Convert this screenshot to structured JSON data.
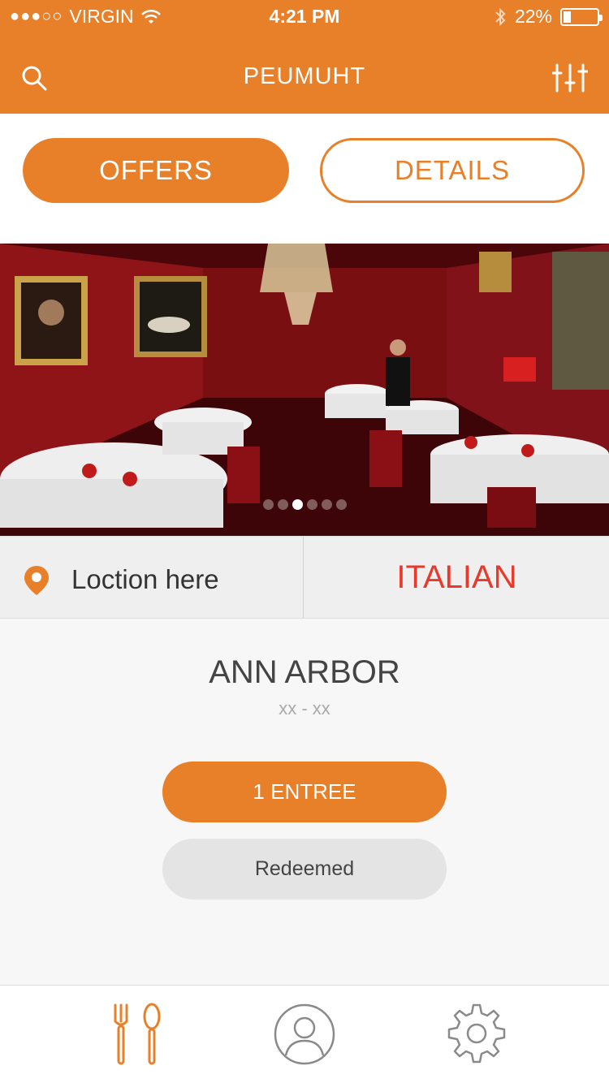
{
  "status_bar": {
    "signal": "●●●○○",
    "carrier": "VIRGIN",
    "time": "4:21 PM",
    "battery": "22%",
    "battery_level": 0.22
  },
  "nav": {
    "title": "PEUMUHT",
    "left_icon": "search-icon",
    "right_icon": "filter-sliders-icon"
  },
  "segments": {
    "offers": "OFFERS",
    "details": "DETAILS",
    "active": "OFFERS"
  },
  "carousel": {
    "image": "restaurant-interior-photo",
    "page_count": 6,
    "active_index": 2
  },
  "info": {
    "location": "Loction here",
    "location_icon": "location-pin-icon",
    "cuisine": "ITALIAN"
  },
  "main": {
    "city": "ANN ARBOR",
    "subtitle": "xx - xx",
    "offer_button": "1 ENTREE",
    "status_button": "Redeemed"
  },
  "tabbar": {
    "items": [
      {
        "icon": "fork-spoon-icon",
        "active": true
      },
      {
        "icon": "profile-icon",
        "active": false
      },
      {
        "icon": "gear-icon",
        "active": false
      }
    ]
  },
  "colors": {
    "accent": "#e8802a",
    "cuisine": "#e8392c",
    "inactive_icon": "#8a8a8a"
  }
}
